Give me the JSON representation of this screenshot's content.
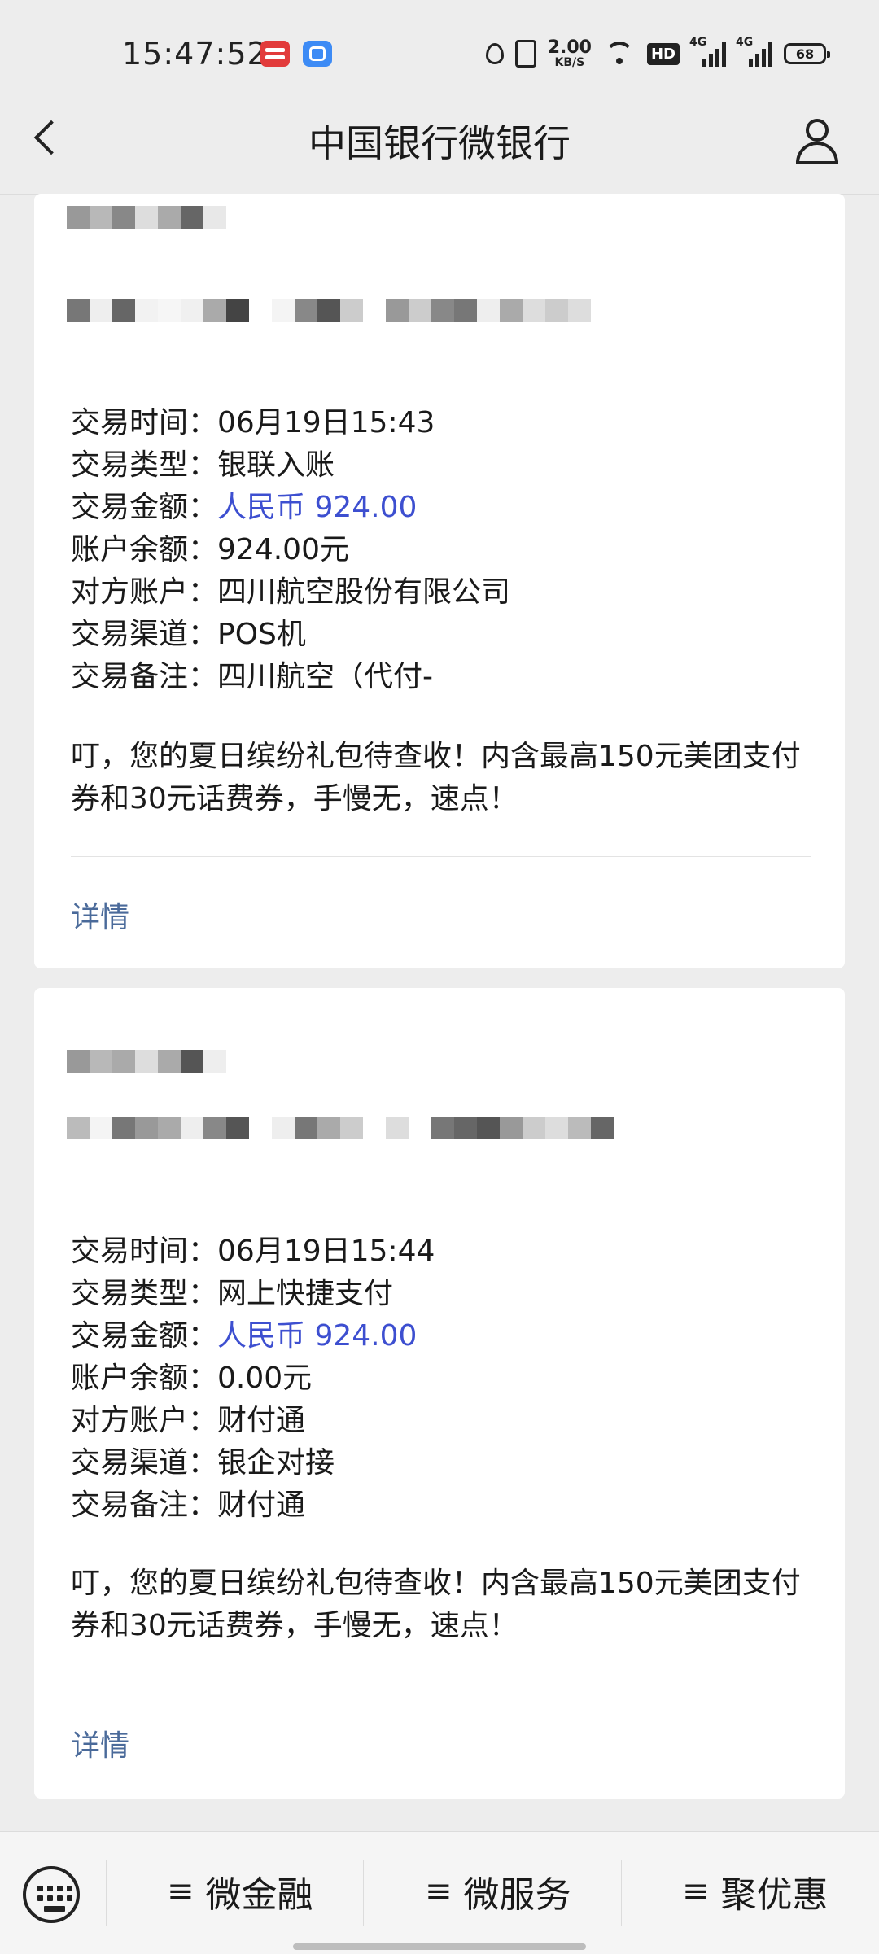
{
  "status_bar": {
    "time": "15:47:52",
    "net_speed_value": "2.00",
    "net_speed_unit": "KB/S",
    "hd_label": "HD",
    "signal1_label": "4G",
    "signal2_label": "4G",
    "battery": "68"
  },
  "header": {
    "title": "中国银行微银行",
    "back_icon": "chevron-left-icon",
    "user_icon": "user-icon"
  },
  "cards": [
    {
      "rows": [
        {
          "label": "交易时间：",
          "value": "06月19日15:43"
        },
        {
          "label": "交易类型：",
          "value": "银联入账"
        },
        {
          "label": "交易金额：",
          "value": "人民币 924.00"
        },
        {
          "label": "账户余额：",
          "value": "924.00元"
        },
        {
          "label": "对方账户：",
          "value": "四川航空股份有限公司"
        },
        {
          "label": "交易渠道：",
          "value": "POS机"
        },
        {
          "label": "交易备注：",
          "value": "四川航空（代付-"
        }
      ],
      "promo": "叮，您的夏日缤纷礼包待查收！内含最高150元美团支付券和30元话费券，手慢无，速点！",
      "detail": "详情"
    },
    {
      "rows": [
        {
          "label": "交易时间：",
          "value": "06月19日15:44"
        },
        {
          "label": "交易类型：",
          "value": "网上快捷支付"
        },
        {
          "label": "交易金额：",
          "value": "人民币 924.00"
        },
        {
          "label": "账户余额：",
          "value": "0.00元"
        },
        {
          "label": "对方账户：",
          "value": "财付通"
        },
        {
          "label": "交易渠道：",
          "value": "银企对接"
        },
        {
          "label": "交易备注：",
          "value": "财付通"
        }
      ],
      "promo": "叮，您的夏日缤纷礼包待查收！内含最高150元美团支付券和30元话费券，手慢无，速点！",
      "detail": "详情"
    }
  ],
  "bottom_bar": {
    "keyboard_icon": "keyboard-icon",
    "menu_icon": "≡",
    "items": [
      "微金融",
      "微服务",
      "聚优惠"
    ]
  },
  "colors": {
    "amount_blue": "#3d4fd0",
    "link_blue": "#4a6a9a",
    "background": "#ededed"
  }
}
